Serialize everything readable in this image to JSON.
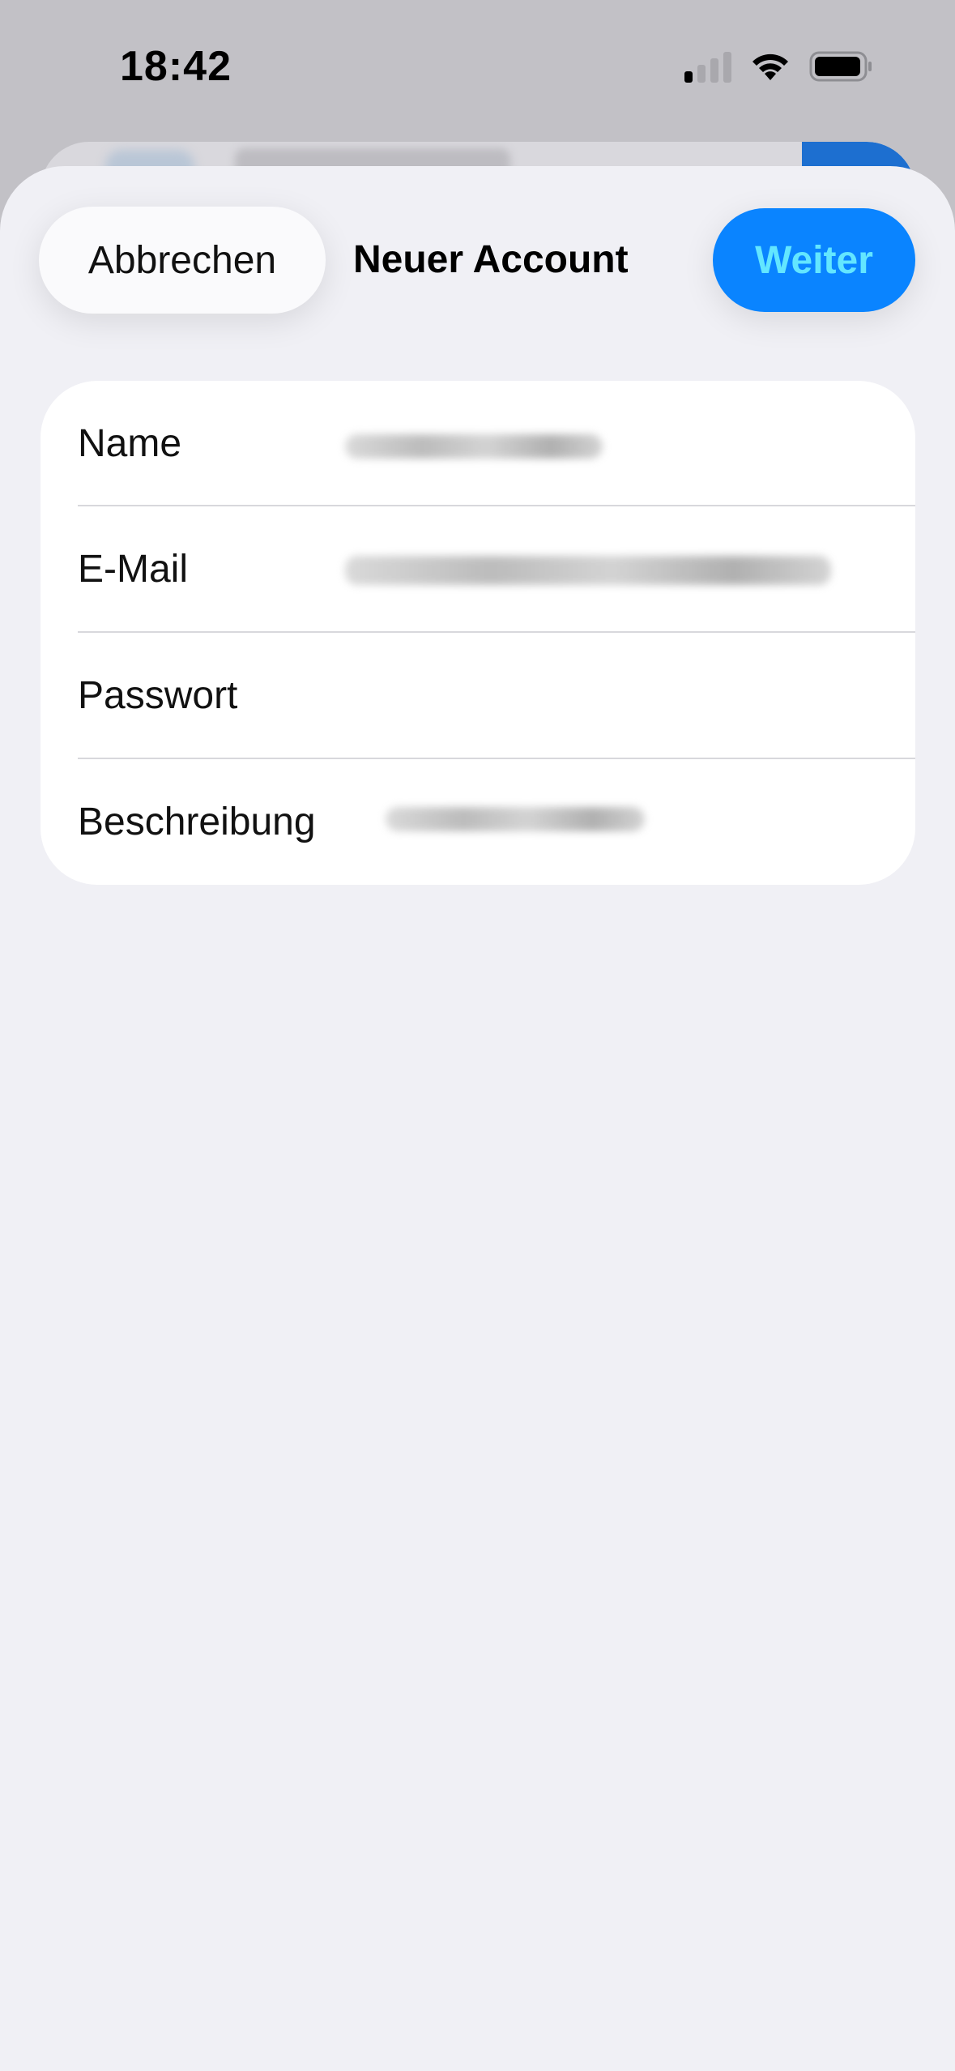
{
  "status_bar": {
    "time": "18:42",
    "icons": [
      "cellular-signal-icon",
      "wifi-icon",
      "battery-icon"
    ],
    "signal_bars_active": 1,
    "signal_bars_total": 4,
    "battery_level": 0.9
  },
  "nav": {
    "cancel_label": "Abbrechen",
    "title": "Neuer Account",
    "next_label": "Weiter",
    "next_color": "#0a84ff",
    "next_text_color": "#63e6ff"
  },
  "form": {
    "fields": [
      {
        "label": "Name",
        "value": "",
        "redacted": true
      },
      {
        "label": "E-Mail",
        "value": "",
        "redacted": true
      },
      {
        "label": "Passwort",
        "value": "",
        "redacted": false
      },
      {
        "label": "Beschreibung",
        "value": "",
        "redacted": true
      }
    ]
  },
  "colors": {
    "sheet_background": "#f0f0f5",
    "card_background": "#ffffff",
    "accent": "#0a84ff"
  }
}
